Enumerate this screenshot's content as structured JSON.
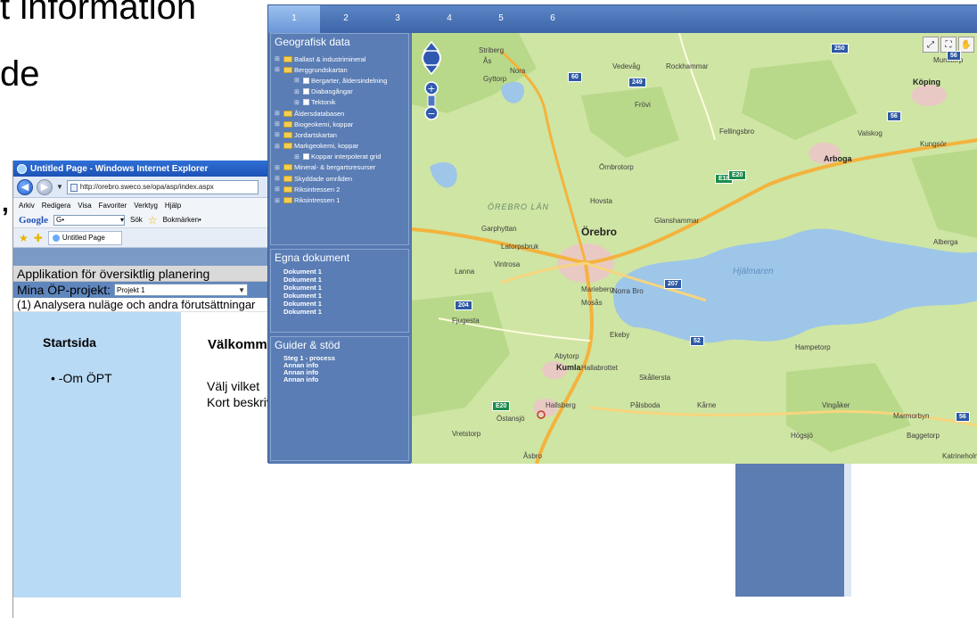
{
  "slide": {
    "line1": "t information",
    "line2": "de",
    "comma": ","
  },
  "browser": {
    "title": "Untitled Page - Windows Internet Explorer",
    "url": "http://orebro.sweco.se/opa/asp/index.aspx",
    "menu": [
      "Arkiv",
      "Redigera",
      "Visa",
      "Favoriter",
      "Verktyg",
      "Hjälp"
    ],
    "google_label": "Google",
    "google_input": "G•",
    "search_label": "Sök",
    "bookmarks_label": "Bokmärken•",
    "tab_label": "Untitled Page"
  },
  "app": {
    "header": "Applikation för översiktlig planering",
    "projects_label": "Mina ÖP-projekt:",
    "project_selected": "Projekt 1",
    "step_text": "(1) Analysera nuläge och andra förutsättningar",
    "nav_title": "Startsida",
    "nav_items": [
      "-Om ÖPT"
    ],
    "welcome": "Välkommen",
    "choose_text": "Välj vilket",
    "short_desc": "Kort beskrivning"
  },
  "map_app": {
    "tabs": [
      "1",
      "2",
      "3",
      "4",
      "5",
      "6"
    ],
    "active_tab": "1",
    "geodata_title": "Geografisk data",
    "layers": [
      {
        "label": "Ballast & industrimineral",
        "level": 0,
        "type": "folder"
      },
      {
        "label": "Berggrundskartan",
        "level": 0,
        "type": "folder"
      },
      {
        "label": "Bergarter, åldersindelning",
        "level": 1,
        "type": "layer"
      },
      {
        "label": "Diabasgångar",
        "level": 1,
        "type": "layer"
      },
      {
        "label": "Tektonik",
        "level": 1,
        "type": "layer"
      },
      {
        "label": "Åldersdatabasen",
        "level": 0,
        "type": "folder"
      },
      {
        "label": "Biogeokemi, koppar",
        "level": 0,
        "type": "folder"
      },
      {
        "label": "Jordartskartan",
        "level": 0,
        "type": "folder"
      },
      {
        "label": "Markgeokemi, koppar",
        "level": 0,
        "type": "folder"
      },
      {
        "label": "Koppar interpolerat grid",
        "level": 1,
        "type": "layer"
      },
      {
        "label": "Mineral- & bergartsresurser",
        "level": 0,
        "type": "folder"
      },
      {
        "label": "Skyddade områden",
        "level": 0,
        "type": "folder"
      },
      {
        "label": "Riksintressen 2",
        "level": 0,
        "type": "folder"
      },
      {
        "label": "Riksintressen 1",
        "level": 0,
        "type": "folder"
      }
    ],
    "docs_title": "Egna dokument",
    "docs": [
      "Dokument 1",
      "Dokument 1",
      "Dokument 1",
      "Dokument 1",
      "Dokument 1",
      "Dokument 1"
    ],
    "guides_title": "Guider & stöd",
    "guides": [
      "Steg 1 - process",
      "Annan info",
      "Annan info",
      "Annan info"
    ],
    "map": {
      "places": [
        {
          "name": "Örebro",
          "cls": "big"
        },
        {
          "name": "Arboga",
          "cls": "med"
        },
        {
          "name": "Köping",
          "cls": "med"
        },
        {
          "name": "Kumla",
          "cls": "med"
        },
        {
          "name": "Hallsberg",
          "cls": ""
        },
        {
          "name": "Striberg",
          "cls": ""
        },
        {
          "name": "Ås",
          "cls": ""
        },
        {
          "name": "Nora",
          "cls": ""
        },
        {
          "name": "Gyttorp",
          "cls": ""
        },
        {
          "name": "Vedevåg",
          "cls": ""
        },
        {
          "name": "Rockhammar",
          "cls": ""
        },
        {
          "name": "Fellingsbro",
          "cls": ""
        },
        {
          "name": "Frövi",
          "cls": ""
        },
        {
          "name": "Glanshammar",
          "cls": ""
        },
        {
          "name": "Hovsta",
          "cls": ""
        },
        {
          "name": "Garphyttan",
          "cls": ""
        },
        {
          "name": "Latorpsbruk",
          "cls": ""
        },
        {
          "name": "Vintrosa",
          "cls": ""
        },
        {
          "name": "Lanna",
          "cls": ""
        },
        {
          "name": "Marieberg",
          "cls": ""
        },
        {
          "name": "Norra Bro",
          "cls": ""
        },
        {
          "name": "Mosås",
          "cls": ""
        },
        {
          "name": "Fjugesta",
          "cls": ""
        },
        {
          "name": "Ekeby",
          "cls": ""
        },
        {
          "name": "Abytorp",
          "cls": ""
        },
        {
          "name": "Skållersta",
          "cls": ""
        },
        {
          "name": "Hallabrottet",
          "cls": ""
        },
        {
          "name": "Pålsboda",
          "cls": ""
        },
        {
          "name": "Kårne",
          "cls": ""
        },
        {
          "name": "Östansjö",
          "cls": ""
        },
        {
          "name": "Vretstorp",
          "cls": ""
        },
        {
          "name": "Åsbro",
          "cls": ""
        },
        {
          "name": "Vingåker",
          "cls": ""
        },
        {
          "name": "Marmorbyn",
          "cls": ""
        },
        {
          "name": "Baggetorp",
          "cls": ""
        },
        {
          "name": "Högsjö",
          "cls": ""
        },
        {
          "name": "Hampetorp",
          "cls": ""
        },
        {
          "name": "Valskog",
          "cls": ""
        },
        {
          "name": "Kungsör",
          "cls": ""
        },
        {
          "name": "Alberga",
          "cls": ""
        },
        {
          "name": "Munktorp",
          "cls": ""
        },
        {
          "name": "Katrineholm",
          "cls": ""
        },
        {
          "name": "Örnbrotorp",
          "cls": ""
        },
        {
          "name": "Hjälmaren",
          "cls": "water"
        },
        {
          "name": "ÖREBRO LÄN",
          "cls": "region"
        }
      ],
      "shields": [
        "250",
        "60",
        "249",
        "56",
        "E18",
        "E20",
        "207",
        "204",
        "52",
        "56",
        "E20",
        "56"
      ],
      "tool_icons": [
        "zoom-box-icon",
        "fullscreen-icon",
        "pan-icon"
      ]
    }
  }
}
